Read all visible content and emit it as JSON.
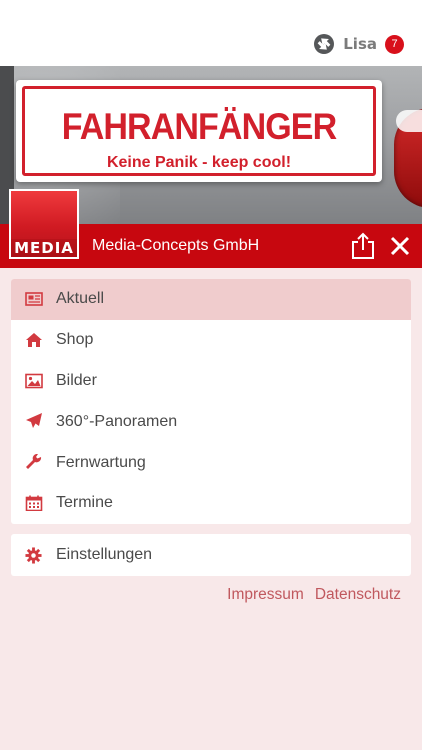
{
  "header": {
    "user_icon": "sync-arrows-icon",
    "user_name": "Lisa",
    "notification_count": "7"
  },
  "banner": {
    "sticker_title": "FAHRANFÄNGER",
    "sticker_subtitle": "Keine Panik - keep cool!"
  },
  "company": {
    "logo_text": "MEDIA",
    "name": "Media-Concepts GmbH",
    "share_icon": "share-icon",
    "close_icon": "close-icon"
  },
  "menu": {
    "items": [
      {
        "label": "Aktuell",
        "icon": "newspaper-icon",
        "active": true
      },
      {
        "label": "Shop",
        "icon": "home-icon",
        "active": false
      },
      {
        "label": "Bilder",
        "icon": "image-icon",
        "active": false
      },
      {
        "label": "360°-Panoramen",
        "icon": "paper-plane-icon",
        "active": false
      },
      {
        "label": "Fernwartung",
        "icon": "wrench-icon",
        "active": false
      },
      {
        "label": "Termine",
        "icon": "calendar-icon",
        "active": false
      }
    ]
  },
  "settings": {
    "label": "Einstellungen",
    "icon": "gear-icon"
  },
  "footer": {
    "impressum": "Impressum",
    "datenschutz": "Datenschutz"
  },
  "colors": {
    "brand_red": "#c7070f",
    "icon_red": "#d23a40",
    "active_bg": "#f0cccd",
    "page_bg": "#f8e8e9",
    "link": "#c0585e"
  }
}
